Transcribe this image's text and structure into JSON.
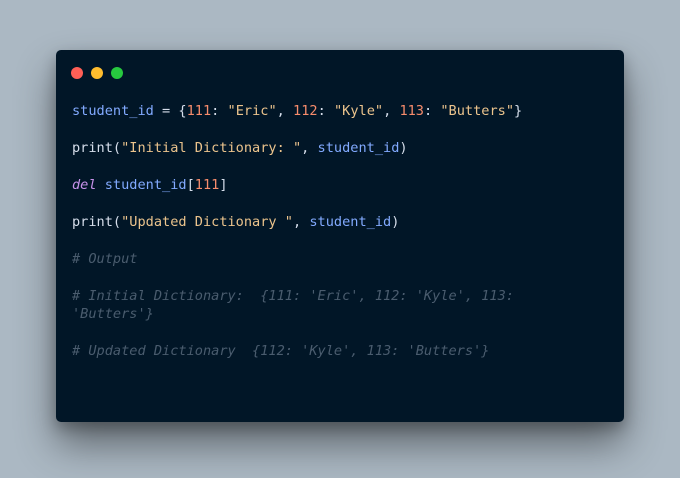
{
  "window": {
    "controls": {
      "close_color": "#ff5f56",
      "minimize_color": "#ffbd2e",
      "zoom_color": "#27c93f"
    },
    "background": "#011627"
  },
  "code": {
    "line1": {
      "var": "student_id",
      "op": " = {",
      "k1": "111",
      "sep1": ": ",
      "v1": "\"Eric\"",
      "comma1": ", ",
      "k2": "112",
      "sep2": ": ",
      "v2": "\"Kyle\"",
      "comma2": ", ",
      "k3": "113",
      "sep3": ": ",
      "v3": "\"Butters\"",
      "close": "}"
    },
    "line2": {
      "fn": "print",
      "open": "(",
      "str": "\"Initial Dictionary: \"",
      "comma": ", ",
      "arg": "student_id",
      "close": ")"
    },
    "line3": {
      "kw": "del",
      "space": " ",
      "var": "student_id",
      "open": "[",
      "key": "111",
      "close": "]"
    },
    "line4": {
      "fn": "print",
      "open": "(",
      "str": "\"Updated Dictionary \"",
      "comma": ", ",
      "arg": "student_id",
      "close": ")"
    },
    "comment_output": "# Output",
    "comment_initial": "# Initial Dictionary:  {111: 'Eric', 112: 'Kyle', 113: 'Butters'}",
    "comment_updated": "# Updated Dictionary  {112: 'Kyle', 113: 'Butters'}"
  }
}
